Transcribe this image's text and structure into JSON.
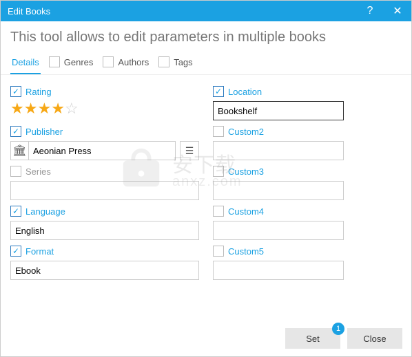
{
  "window": {
    "title": "Edit Books"
  },
  "subtitle": "This tool allows to edit parameters in multiple books",
  "tabs": {
    "details": "Details",
    "genres": "Genres",
    "authors": "Authors",
    "tags": "Tags"
  },
  "left": {
    "rating": {
      "label": "Rating",
      "value": 4,
      "max": 5
    },
    "publisher": {
      "label": "Publisher",
      "value": "Aeonian Press"
    },
    "series": {
      "label": "Series",
      "value": ""
    },
    "language": {
      "label": "Language",
      "value": "English"
    },
    "format": {
      "label": "Format",
      "value": "Ebook"
    }
  },
  "right": {
    "location": {
      "label": "Location",
      "value": "Bookshelf"
    },
    "custom2": {
      "label": "Custom2",
      "value": ""
    },
    "custom3": {
      "label": "Custom3",
      "value": ""
    },
    "custom4": {
      "label": "Custom4",
      "value": ""
    },
    "custom5": {
      "label": "Custom5",
      "value": ""
    }
  },
  "footer": {
    "set": "Set",
    "close": "Close",
    "badge": "1"
  },
  "watermark": {
    "text": "安下载",
    "domain": "anxz.com"
  }
}
